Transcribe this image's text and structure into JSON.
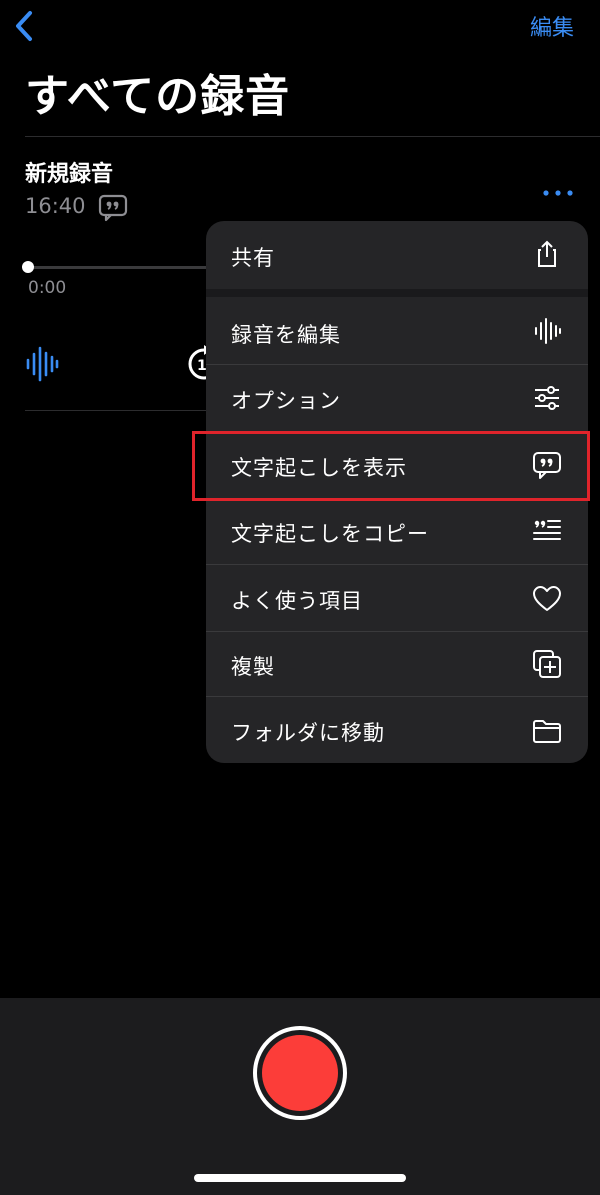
{
  "nav": {
    "back_icon": "chevron-left-icon",
    "edit_label": "編集"
  },
  "page_title": "すべての録音",
  "recording": {
    "title": "新規録音",
    "time": "16:40",
    "elapsed": "0:00",
    "progress": 0
  },
  "menu": {
    "items": [
      {
        "label": "共有",
        "icon": "share-icon"
      },
      {
        "label": "録音を編集",
        "icon": "waveform-icon"
      },
      {
        "label": "オプション",
        "icon": "sliders-icon"
      },
      {
        "label": "文字起こしを表示",
        "icon": "quote-bubble-icon",
        "highlighted": true
      },
      {
        "label": "文字起こしをコピー",
        "icon": "quote-text-icon"
      },
      {
        "label": "よく使う項目",
        "icon": "heart-icon"
      },
      {
        "label": "複製",
        "icon": "duplicate-icon"
      },
      {
        "label": "フォルダに移動",
        "icon": "folder-icon"
      }
    ]
  },
  "colors": {
    "accent": "#3a8cf3",
    "record": "#fc3d39",
    "highlight": "#e0242b",
    "menu_bg": "#252527",
    "bottom_bar_bg": "#1c1c1e"
  }
}
